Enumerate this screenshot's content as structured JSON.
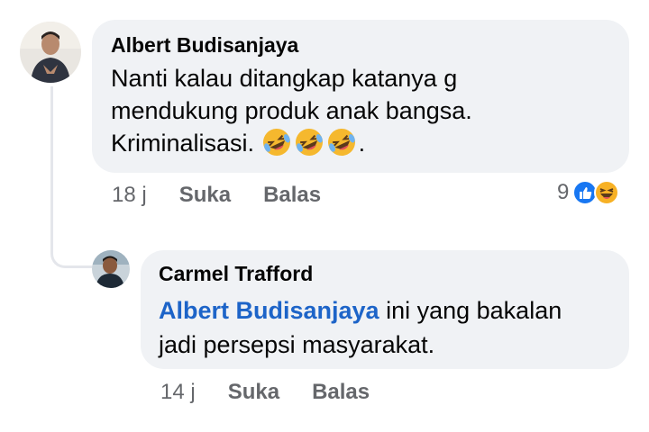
{
  "comments": [
    {
      "author": "Albert Budisanjaya",
      "text_line1": "Nanti kalau ditangkap katanya g",
      "text_line2": "mendukung produk anak bangsa.",
      "text_line3": "Kriminalisasi.",
      "text_line3_end": ".",
      "emojis": [
        "rolling-laughing-emoji",
        "rolling-laughing-emoji",
        "rolling-laughing-emoji"
      ],
      "time": "18 j",
      "like_label": "Suka",
      "reply_label": "Balas",
      "reaction_count": "9",
      "reactions": [
        "like-reaction-icon",
        "haha-reaction-icon"
      ]
    },
    {
      "author": "Carmel Trafford",
      "mention": "Albert Budisanjaya",
      "text_rest_line1": " ini yang bakalan",
      "text_line2": "jadi persepsi masyarakat.",
      "time": "14 j",
      "like_label": "Suka",
      "reply_label": "Balas"
    }
  ],
  "colors": {
    "bubble": "#f0f2f5",
    "mention": "#1d64c8",
    "meta": "#65676b",
    "like_blue": "#1877f2"
  }
}
